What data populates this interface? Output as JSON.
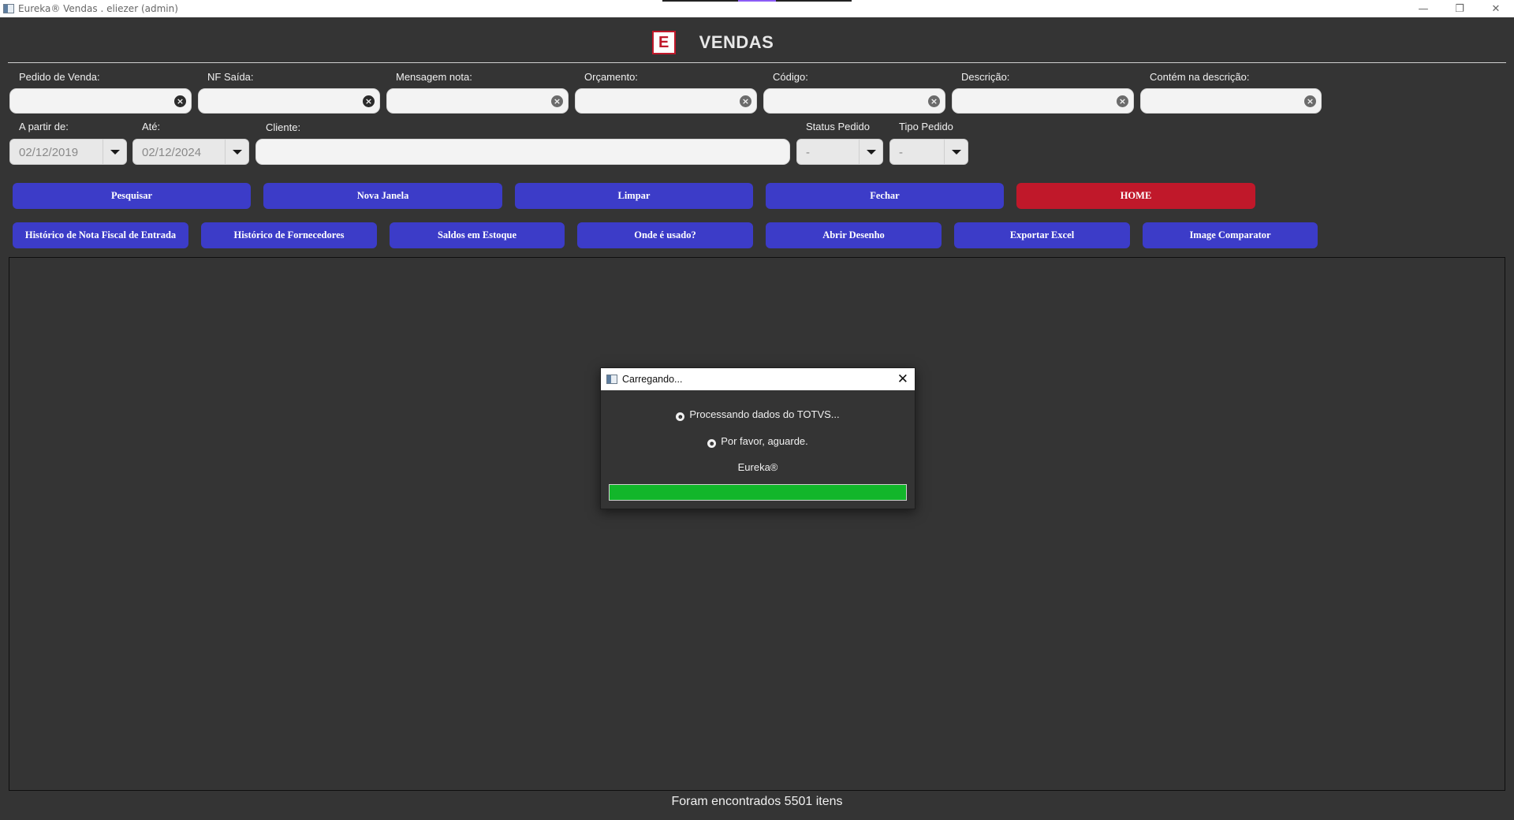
{
  "window": {
    "title": "Eureka® Vendas . eliezer (admin)",
    "minimize": "—",
    "restore": "❐",
    "close": "✕"
  },
  "header": {
    "logo_letter": "E",
    "title": "VENDAS"
  },
  "filters": {
    "row1": [
      {
        "label": "Pedido de Venda:",
        "value": ""
      },
      {
        "label": "NF Saída:",
        "value": ""
      },
      {
        "label": "Mensagem nota:",
        "value": ""
      },
      {
        "label": "Orçamento:",
        "value": ""
      },
      {
        "label": "Código:",
        "value": ""
      },
      {
        "label": "Descrição:",
        "value": ""
      },
      {
        "label": "Contém na descrição:",
        "value": ""
      }
    ],
    "date_from": {
      "label": "A partir de:",
      "value": "02/12/2019"
    },
    "date_to": {
      "label": "Até:",
      "value": "02/12/2024"
    },
    "client": {
      "label": "Cliente:",
      "value": ""
    },
    "status": {
      "label": "Status Pedido",
      "value": "-"
    },
    "type": {
      "label": "Tipo Pedido",
      "value": "-"
    }
  },
  "buttons_row1": [
    "Pesquisar",
    "Nova Janela",
    "Limpar",
    "Fechar",
    "HOME"
  ],
  "buttons_row2": [
    "Histórico de Nota Fiscal de Entrada",
    "Histórico de Fornecedores",
    "Saldos em Estoque",
    "Onde é usado?",
    "Abrir Desenho",
    "Exportar Excel",
    "Image Comparator"
  ],
  "colors": {
    "button": "#3c3cc8",
    "home_button": "#c0182a",
    "progress": "#12b62a",
    "background": "#343434"
  },
  "dialog": {
    "title": "Carregando...",
    "line1": "Processando dados do TOTVS...",
    "line2": "Por favor, aguarde.",
    "line3": "Eureka®",
    "progress": 1.0
  },
  "status_text": "Foram encontrados 5501 itens"
}
